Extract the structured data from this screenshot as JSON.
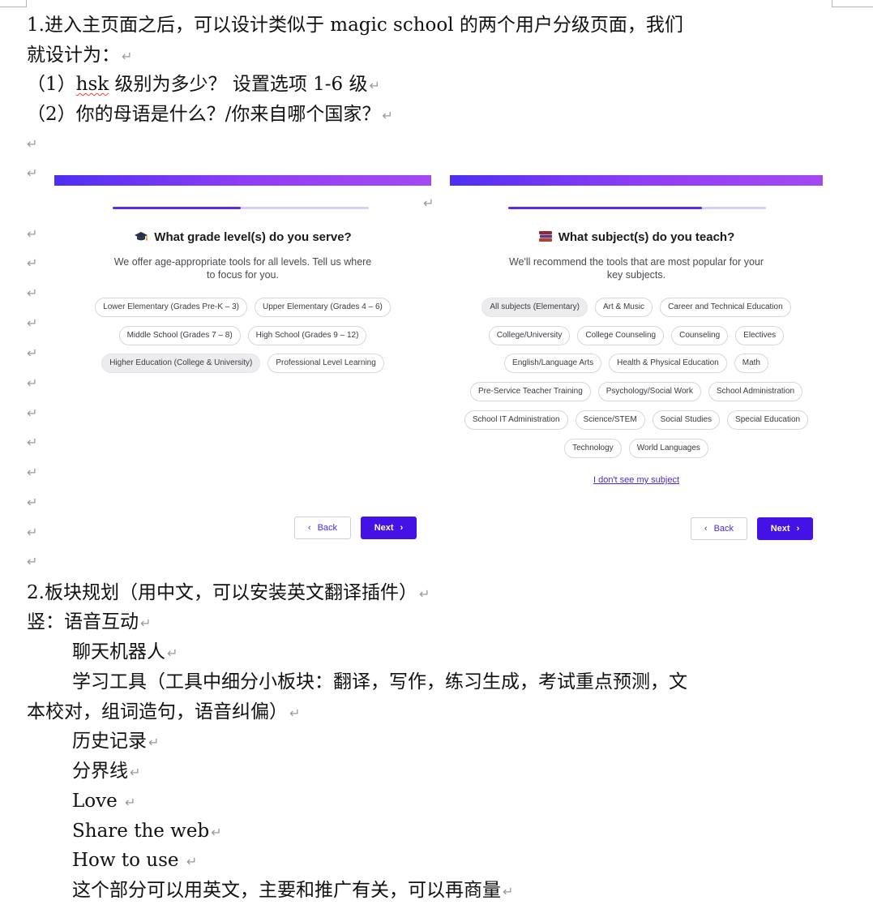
{
  "doc": {
    "line1a": "1.进入主页面之后，可以设计类似于 magic school 的两个用户分级页面，我们",
    "line1b": "就设计为：",
    "item1_pre": "（1）",
    "item1_word": "hsk",
    "item1_post": " 级别为多少？ 设置选项 1-6 级",
    "item2": "（2）你的母语是什么？/你来自哪个国家？",
    "section2": "2.板块规划（用中文，可以安装英文翻译插件）",
    "vertical_intro": "竖：语音互动",
    "chatbot": "聊天机器人",
    "tools_a": "学习工具（工具中细分小板块：翻译，写作，练习生成，考试重点预测，文",
    "tools_b": "本校对，组词造句，语音纠偏）",
    "history": "历史记录",
    "divider": "分界线",
    "love": "Love ",
    "share": "Share the web",
    "howto": "How to use ",
    "promo": "这个部分可以用英文，主要和推广有关，可以再商量",
    "para_mark": "↵"
  },
  "left_panel": {
    "title": "What grade level(s) do you serve?",
    "icon": "graduation-cap-icon",
    "subtitle_line1": "We offer age-appropriate tools for all levels. Tell us where",
    "subtitle_line2": "to focus for you.",
    "progress": 0.5,
    "chip_rows": [
      [
        {
          "label": "Lower Elementary (Grades Pre-K – 3)",
          "selected": false
        },
        {
          "label": "Upper Elementary (Grades 4 – 6)",
          "selected": false
        }
      ],
      [
        {
          "label": "Middle School (Grades 7 – 8)",
          "selected": false
        },
        {
          "label": "High School (Grades 9 – 12)",
          "selected": false
        }
      ],
      [
        {
          "label": "Higher Education (College & University)",
          "selected": true
        },
        {
          "label": "Professional Level Learning",
          "selected": false
        }
      ]
    ],
    "back_label": "Back",
    "next_label": "Next"
  },
  "right_panel": {
    "title": "What subject(s) do you teach?",
    "icon": "books-icon",
    "subtitle_line1": "We'll recommend the tools that are most popular for your",
    "subtitle_line2": "key subjects.",
    "progress": 0.75,
    "chip_rows": [
      [
        {
          "label": "All subjects (Elementary)",
          "selected": true
        },
        {
          "label": "Art & Music",
          "selected": false
        },
        {
          "label": "Career and Technical Education",
          "selected": false
        }
      ],
      [
        {
          "label": "College/University",
          "selected": false
        },
        {
          "label": "College Counseling",
          "selected": false
        },
        {
          "label": "Counseling",
          "selected": false
        },
        {
          "label": "Electives",
          "selected": false
        }
      ],
      [
        {
          "label": "English/Language Arts",
          "selected": false
        },
        {
          "label": "Health & Physical Education",
          "selected": false
        },
        {
          "label": "Math",
          "selected": false
        }
      ],
      [
        {
          "label": "Pre-Service Teacher Training",
          "selected": false
        },
        {
          "label": "Psychology/Social Work",
          "selected": false
        },
        {
          "label": "School Administration",
          "selected": false
        }
      ],
      [
        {
          "label": "School IT Administration",
          "selected": false
        },
        {
          "label": "Science/STEM",
          "selected": false
        },
        {
          "label": "Social Studies",
          "selected": false
        },
        {
          "label": "Special Education",
          "selected": false
        }
      ],
      [
        {
          "label": "Technology",
          "selected": false
        },
        {
          "label": "World Languages",
          "selected": false
        }
      ]
    ],
    "missing_link": "I don't see my subject",
    "back_label": "Back",
    "next_label": "Next"
  },
  "colors": {
    "accent": "#4512e6",
    "gradient_start": "#4f2ff3",
    "gradient_end": "#a449f2",
    "spell_error": "#e0463c"
  }
}
